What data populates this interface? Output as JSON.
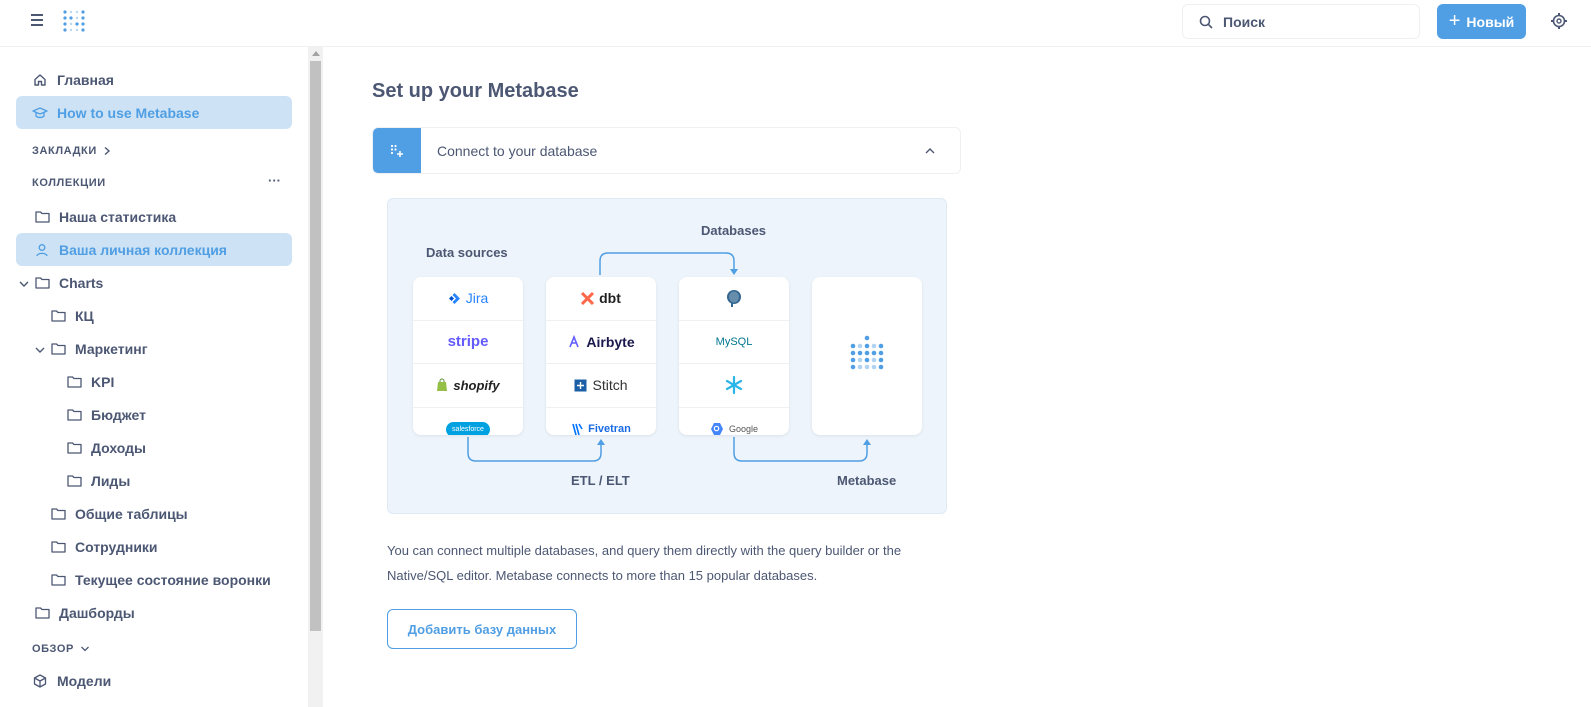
{
  "topbar": {
    "search_placeholder": "Поиск",
    "new_button": "Новый"
  },
  "sidebar": {
    "home": "Главная",
    "how_to": "How to use Metabase",
    "bookmarks_header": "ЗАКЛАДКИ",
    "collections_header": "КОЛЛЕКЦИИ",
    "collections_more": "···",
    "items": [
      {
        "label": "Наша статистика"
      },
      {
        "label": "Ваша личная коллекция"
      },
      {
        "label": "Charts"
      },
      {
        "label": "КЦ"
      },
      {
        "label": "Маркетинг"
      },
      {
        "label": "KPI"
      },
      {
        "label": "Бюджет"
      },
      {
        "label": "Доходы"
      },
      {
        "label": "Лиды"
      },
      {
        "label": "Общие таблицы"
      },
      {
        "label": "Сотрудники"
      },
      {
        "label": "Текущее состояние воронки"
      },
      {
        "label": "Дашборды"
      }
    ],
    "browse_header": "ОБЗОР",
    "models": "Модели"
  },
  "main": {
    "title": "Set up your Metabase",
    "accordion_label": "Connect to your database",
    "illustration": {
      "data_sources_label": "Data sources",
      "databases_label": "Databases",
      "etl_label": "ETL / ELT",
      "metabase_label": "Metabase",
      "sources": [
        "Jira",
        "stripe",
        "shopify",
        "salesforce"
      ],
      "etl_tools": [
        "dbt",
        "Airbyte",
        "Stitch",
        "Fivetran"
      ],
      "databases": [
        "MySQL",
        "Google"
      ]
    },
    "description": "You can connect multiple databases, and query them directly with the query builder or the Native/SQL editor. Metabase connects to more than 15 popular databases.",
    "add_db_button": "Добавить базу данных"
  },
  "colors": {
    "brand": "#509ee3",
    "text": "#4c5773",
    "active_bg": "#cde3f5"
  }
}
